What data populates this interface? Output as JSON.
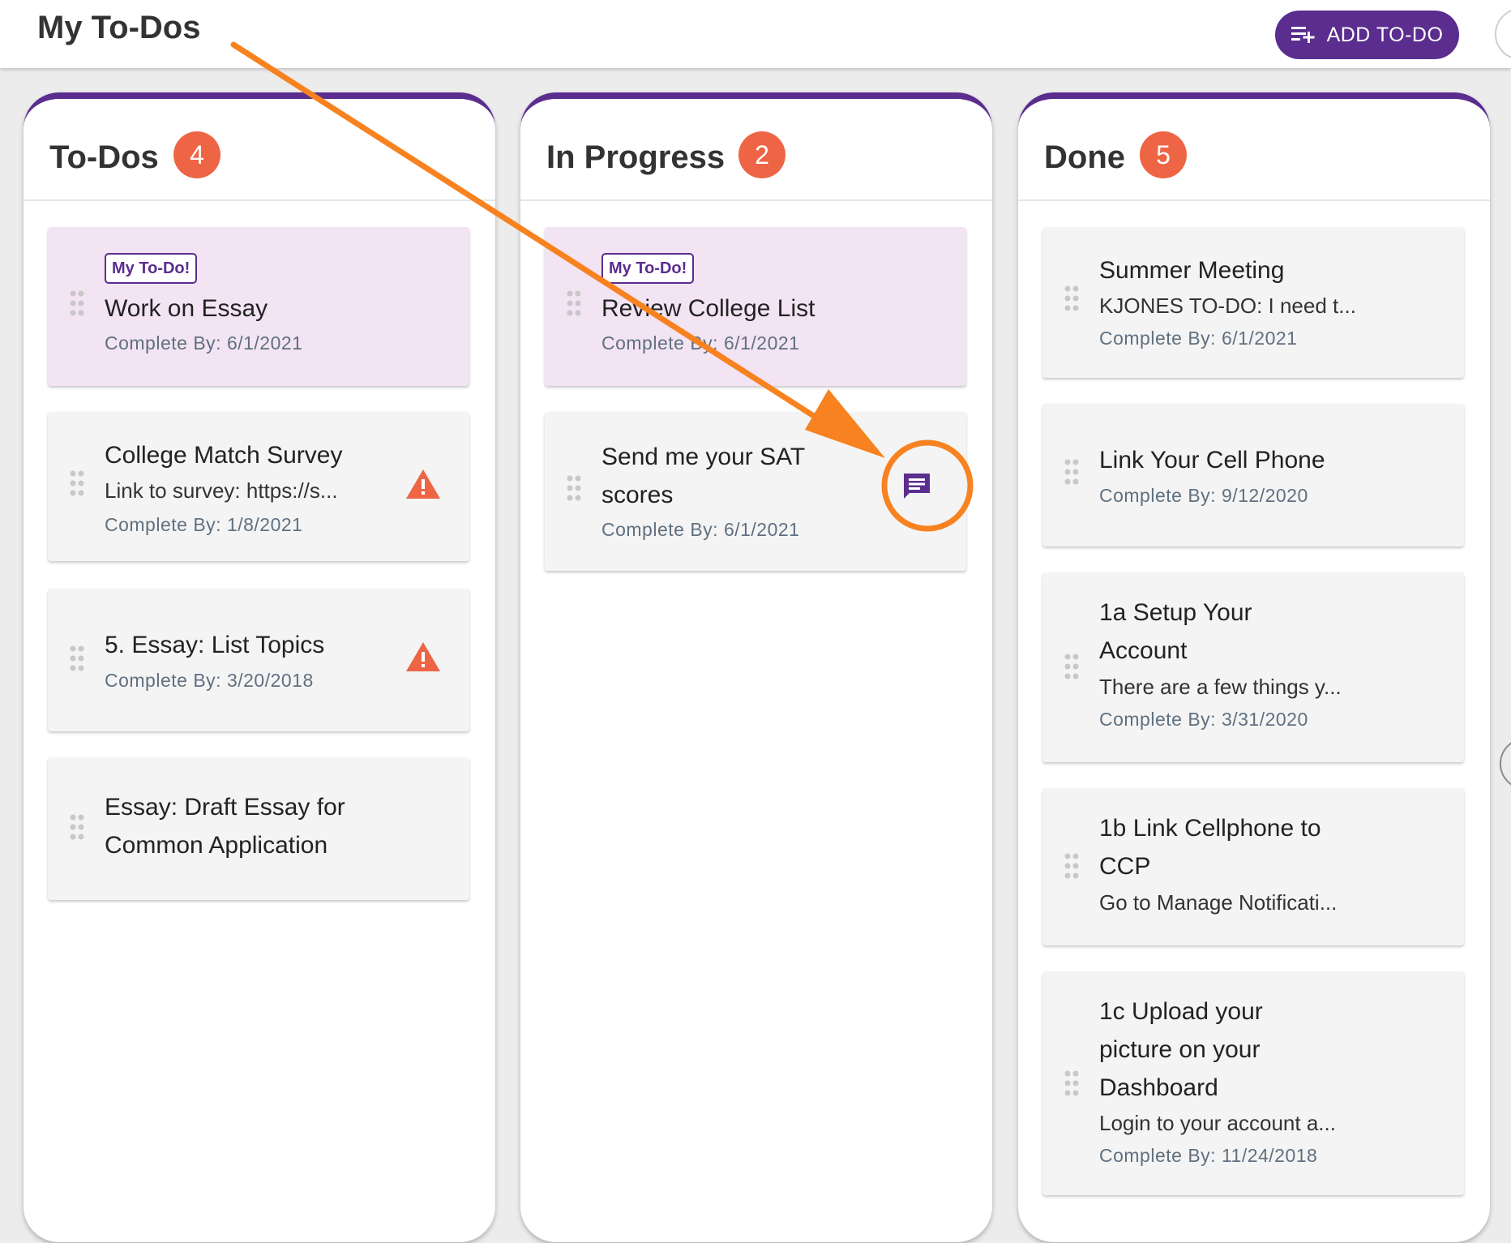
{
  "header": {
    "title": "My To-Dos",
    "add_button_label": "ADD TO-DO"
  },
  "columns": [
    {
      "title": "To-Dos",
      "count": "4",
      "cards": [
        {
          "tag": "My To-Do!",
          "title": "Work on Essay",
          "date": "Complete By: 6/1/2021"
        },
        {
          "title": "College Match Survey",
          "desc": "Link to survey: https://s...",
          "date": "Complete By: 1/8/2021",
          "icon": "warning-icon"
        },
        {
          "title": "5. Essay: List Topics",
          "date": "Complete By: 3/20/2018",
          "icon": "warning-icon"
        },
        {
          "title": "Essay: Draft Essay for Common Application"
        }
      ]
    },
    {
      "title": "In Progress",
      "count": "2",
      "cards": [
        {
          "tag": "My To-Do!",
          "title": "Review College List",
          "date": "Complete By: 6/1/2021"
        },
        {
          "title": "Send me your SAT scores",
          "date": "Complete By: 6/1/2021",
          "icon": "chat-icon"
        }
      ]
    },
    {
      "title": "Done",
      "count": "5",
      "cards": [
        {
          "title": "Summer Meeting",
          "desc": "KJONES TO-DO: I need t...",
          "date": "Complete By: 6/1/2021"
        },
        {
          "title": "Link Your Cell Phone",
          "date": "Complete By: 9/12/2020"
        },
        {
          "title": "1a Setup Your Account",
          "desc": "There are a few things y...",
          "date": "Complete By: 3/31/2020"
        },
        {
          "title": "1b Link Cellphone to CCP",
          "desc": "Go to Manage Notificati..."
        },
        {
          "title": "1c Upload your picture on your Dashboard",
          "desc": "Login to your account a...",
          "date": "Complete By: 11/24/2018"
        }
      ]
    }
  ],
  "colors": {
    "brand_purple": "#5b2d8e",
    "badge_orange": "#ee6545",
    "annotation_orange": "#f7821f",
    "my_todo_bg": "#f2e4f3"
  }
}
